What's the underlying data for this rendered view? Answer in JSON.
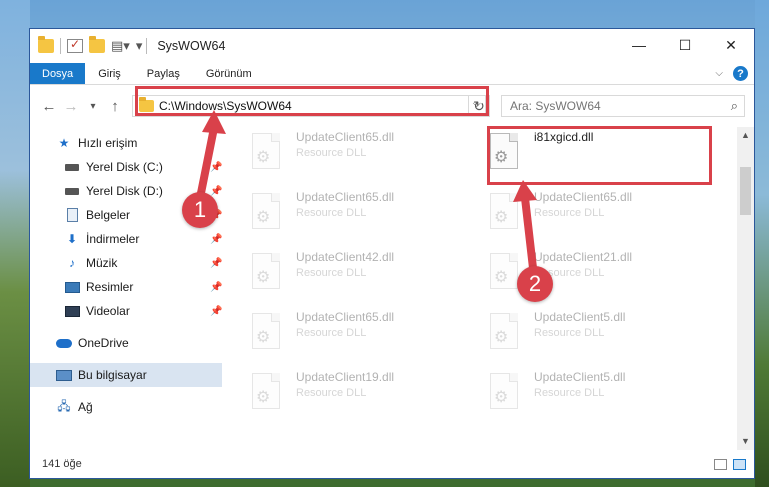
{
  "window": {
    "title": "SysWOW64",
    "controls": {
      "minimize": "—",
      "maximize": "☐",
      "close": "✕"
    }
  },
  "ribbon": {
    "tabs": [
      "Dosya",
      "Giriş",
      "Paylaş",
      "Görünüm"
    ]
  },
  "navigation": {
    "address": "C:\\Windows\\SysWOW64",
    "search_placeholder": "Ara: SysWOW64"
  },
  "sidebar": {
    "items": [
      {
        "label": "Hızlı erişim",
        "icon": "star-icon"
      },
      {
        "label": "Yerel Disk (C:)",
        "icon": "drive-icon",
        "pinned": true
      },
      {
        "label": "Yerel Disk (D:)",
        "icon": "drive-icon",
        "pinned": true
      },
      {
        "label": "Belgeler",
        "icon": "document-icon",
        "pinned": true
      },
      {
        "label": "İndirmeler",
        "icon": "download-icon",
        "pinned": true
      },
      {
        "label": "Müzik",
        "icon": "music-icon",
        "pinned": true
      },
      {
        "label": "Resimler",
        "icon": "pictures-icon",
        "pinned": true
      },
      {
        "label": "Videolar",
        "icon": "videos-icon",
        "pinned": true
      },
      {
        "label": "OneDrive",
        "icon": "onedrive-icon"
      },
      {
        "label": "Bu bilgisayar",
        "icon": "this-pc-icon",
        "selected": true
      },
      {
        "label": "Ağ",
        "icon": "network-icon"
      }
    ]
  },
  "files": [
    {
      "name": "UpdateClient65.dll",
      "desc": "Resource DLL",
      "faded": true
    },
    {
      "name": "i81xgicd.dll",
      "desc": "",
      "faded": false
    },
    {
      "name": "UpdateClient65.dll",
      "desc": "Resource DLL",
      "faded": true
    },
    {
      "name": "UpdateClient65.dll",
      "desc": "Resource DLL",
      "faded": true
    },
    {
      "name": "UpdateClient42.dll",
      "desc": "Resource DLL",
      "faded": true
    },
    {
      "name": "UpdateClient21.dll",
      "desc": "Resource DLL",
      "faded": true
    },
    {
      "name": "UpdateClient65.dll",
      "desc": "Resource DLL",
      "faded": true
    },
    {
      "name": "UpdateClient5.dll",
      "desc": "Resource DLL",
      "faded": true
    },
    {
      "name": "UpdateClient19.dll",
      "desc": "Resource DLL",
      "faded": true
    },
    {
      "name": "UpdateClient5.dll",
      "desc": "Resource DLL",
      "faded": true
    }
  ],
  "status": {
    "item_count": "141 öğe"
  },
  "annotations": {
    "marker_1": "1",
    "marker_2": "2",
    "color": "#d9414a"
  }
}
